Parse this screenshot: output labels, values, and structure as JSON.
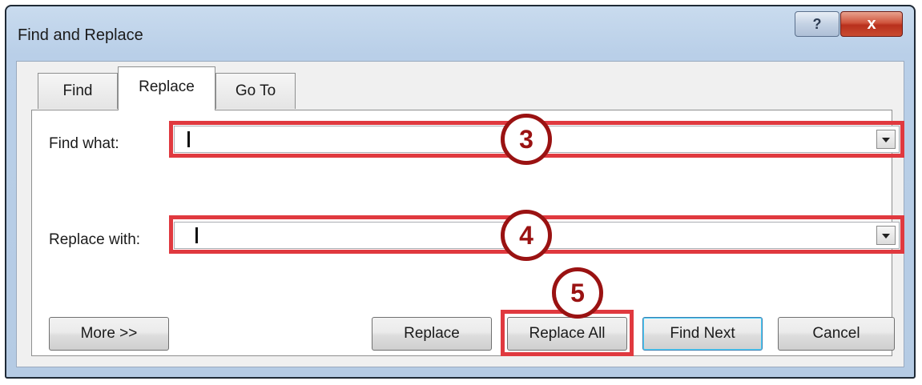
{
  "window": {
    "title": "Find and Replace",
    "help_label": "?",
    "close_label": "x"
  },
  "tabs": [
    {
      "label": "Find",
      "active": false
    },
    {
      "label": "Replace",
      "active": true
    },
    {
      "label": "Go To",
      "active": false
    }
  ],
  "fields": {
    "find_what_label": "Find what:",
    "find_what_value": "",
    "replace_with_label": "Replace with:",
    "replace_with_value": ""
  },
  "buttons": {
    "more": "More >>",
    "replace": "Replace",
    "replace_all": "Replace All",
    "find_next": "Find Next",
    "cancel": "Cancel"
  },
  "annotations": {
    "step_find": "3",
    "step_replace": "4",
    "step_replace_all": "5",
    "highlight_color": "#e0393f",
    "circle_color": "#9a1212"
  },
  "icons": {
    "dropdown": "chevron-down-icon",
    "help": "help-icon",
    "close": "close-icon"
  }
}
